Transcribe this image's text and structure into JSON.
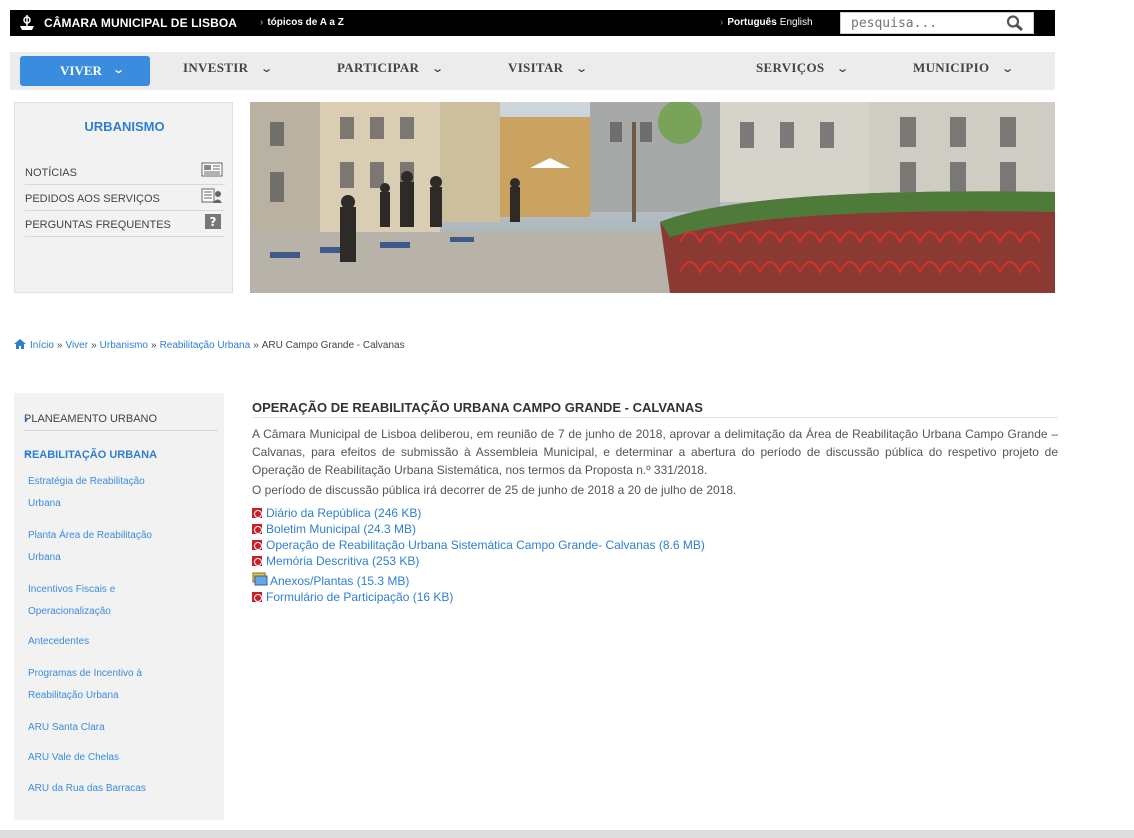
{
  "header": {
    "site_name": "CÂMARA MUNICIPAL DE LISBOA",
    "topics_link": "tópicos de A a Z",
    "lang_pt": "Português",
    "lang_en": "English",
    "search_placeholder": "pesquisa..."
  },
  "nav": {
    "items": [
      "VIVER",
      "INVESTIR",
      "PARTICIPAR",
      "VISITAR",
      "SERVIÇOS",
      "MUNICIPIO"
    ]
  },
  "urbanismo": {
    "title": "URBANISMO",
    "items": [
      "NOTÍCIAS",
      "PEDIDOS AOS SERVIÇOS",
      "PERGUNTAS FREQUENTES"
    ]
  },
  "breadcrumb": {
    "items": [
      "Início",
      "Viver",
      "Urbanismo",
      "Reabilitação Urbana"
    ],
    "current": "ARU Campo Grande - Calvanas",
    "sep": "»"
  },
  "sidebar": {
    "top_item": "PLANEAMENTO URBANO",
    "active_item": "REABILITAÇÃO URBANA",
    "sub_items": [
      "Estratégia de Reabilitação Urbana",
      "Planta Área de Reabilitação Urbana",
      "Incentivos Fiscais e Operacionalização",
      "Antecedentes",
      "Programas de Incentivo à Reabilitação Urbana",
      "ARU Santa Clara",
      "ARU Vale de Chelas",
      "ARU da Rua das Barracas"
    ]
  },
  "content": {
    "title": "OPERAÇÃO DE REABILITAÇÃO URBANA CAMPO GRANDE - CALVANAS",
    "paragraph1": "A Câmara Municipal de Lisboa deliberou, em reunião de 7 de junho de 2018, aprovar a delimitação da Área de Reabilitação Urbana Campo Grande – Calvanas, para efeitos de submissão à Assembleia Municipal, e determinar a abertura do período de discussão pública do respetivo projeto de Operação de Reabilitação Urbana Sistemática, nos termos da Proposta n.º 331/2018.",
    "paragraph2": "O período de discussão pública irá decorrer de 25 de junho de 2018 a 20 de julho de 2018.",
    "documents": [
      "Diário da República (246 KB)",
      "Boletim Municipal (24.3 MB)",
      "Operação de Reabilitação Urbana Sistemática Campo Grande- Calvanas (8.6 MB)",
      "Memória Descritiva (253 KB)",
      "Anexos/Plantas (15.3 MB)",
      "Formulário de Participação (16 KB)"
    ]
  },
  "colors": {
    "accent": "#3a8dde",
    "link": "#2f7fd0",
    "pdf": "#c8202a"
  }
}
